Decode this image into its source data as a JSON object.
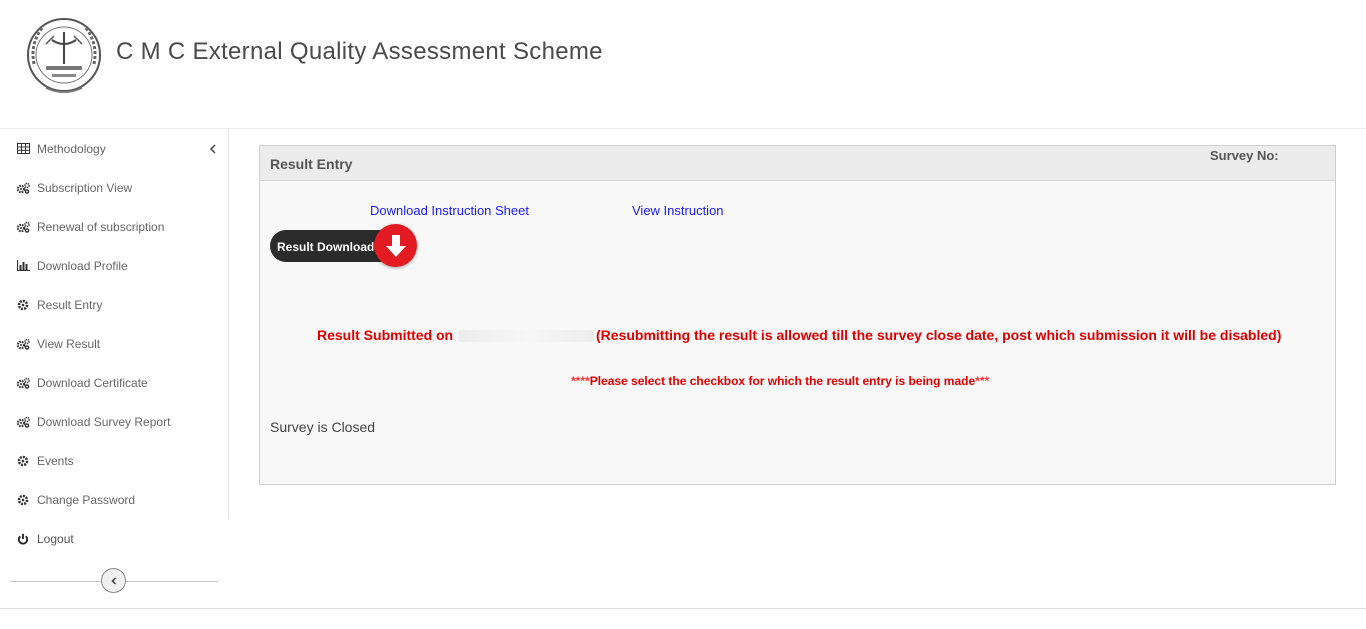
{
  "header": {
    "title": "C M C External Quality Assessment Scheme",
    "logo_icon": "college-seal-logo"
  },
  "sidebar": {
    "items": [
      {
        "label": "Methodology",
        "icon": "table-icon"
      },
      {
        "label": "Subscription View",
        "icon": "gears-icon"
      },
      {
        "label": "Renewal of subscription",
        "icon": "gears-icon"
      },
      {
        "label": "Download Profile",
        "icon": "bar-chart-icon"
      },
      {
        "label": "Result Entry",
        "icon": "gear-icon"
      },
      {
        "label": "View Result",
        "icon": "gears-icon"
      },
      {
        "label": "Download Certificate",
        "icon": "gears-icon"
      },
      {
        "label": "Download Survey Report",
        "icon": "gears-icon"
      },
      {
        "label": "Events",
        "icon": "gear-icon"
      },
      {
        "label": "Change Password",
        "icon": "gear-icon"
      }
    ],
    "logout": {
      "label": "Logout",
      "icon": "power-icon"
    }
  },
  "panel": {
    "title": "Result Entry",
    "survey_no": "Survey No:",
    "link_instruction_sheet": "Download Instruction Sheet",
    "link_view_instruction": "View Instruction",
    "result_download_label": "Result Download",
    "submitted_prefix": "Result Submitted on",
    "submitted_suffix": "(Resubmitting the result is allowed till the survey close date, post which submission it will be disabled)",
    "note_stars_left": "****",
    "note_text": "Please select the checkbox for which the result entry is being made",
    "note_stars_right": "***",
    "status_text": "Survey is Closed"
  },
  "colors": {
    "accent_red": "#e00000",
    "link_blue": "#1a1aff",
    "download_red": "#e31b23"
  }
}
